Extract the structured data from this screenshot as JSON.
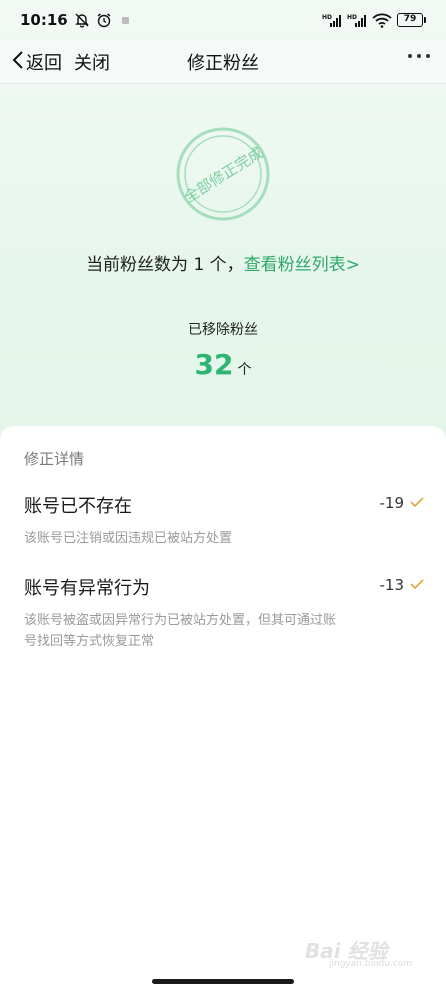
{
  "status_bar": {
    "time": "10:16",
    "battery": "79",
    "network_label": "HD"
  },
  "nav": {
    "back_label": "返回",
    "close_label": "关闭",
    "title": "修正粉丝"
  },
  "stamp": {
    "text": "全部修正完成",
    "color": "#7ccf9f"
  },
  "summary": {
    "prefix": "当前粉丝数为 1 个，",
    "link": "查看粉丝列表>"
  },
  "removed": {
    "label": "已移除粉丝",
    "count": "32",
    "unit": "个"
  },
  "details": {
    "title": "修正详情",
    "items": [
      {
        "name": "账号已不存在",
        "description": "该账号已注销或因违规已被站方处置",
        "value": "-19"
      },
      {
        "name": "账号有异常行为",
        "description": "该账号被盗或因异常行为已被站方处置，但其可通过账号找回等方式恢复正常",
        "value": "-13"
      }
    ]
  },
  "watermark": {
    "main": "Bai 经验",
    "sub": "jingyan.baidu.com"
  },
  "colors": {
    "accent": "#2fb472",
    "link": "#2fa86a",
    "check": "#e0a43a"
  }
}
